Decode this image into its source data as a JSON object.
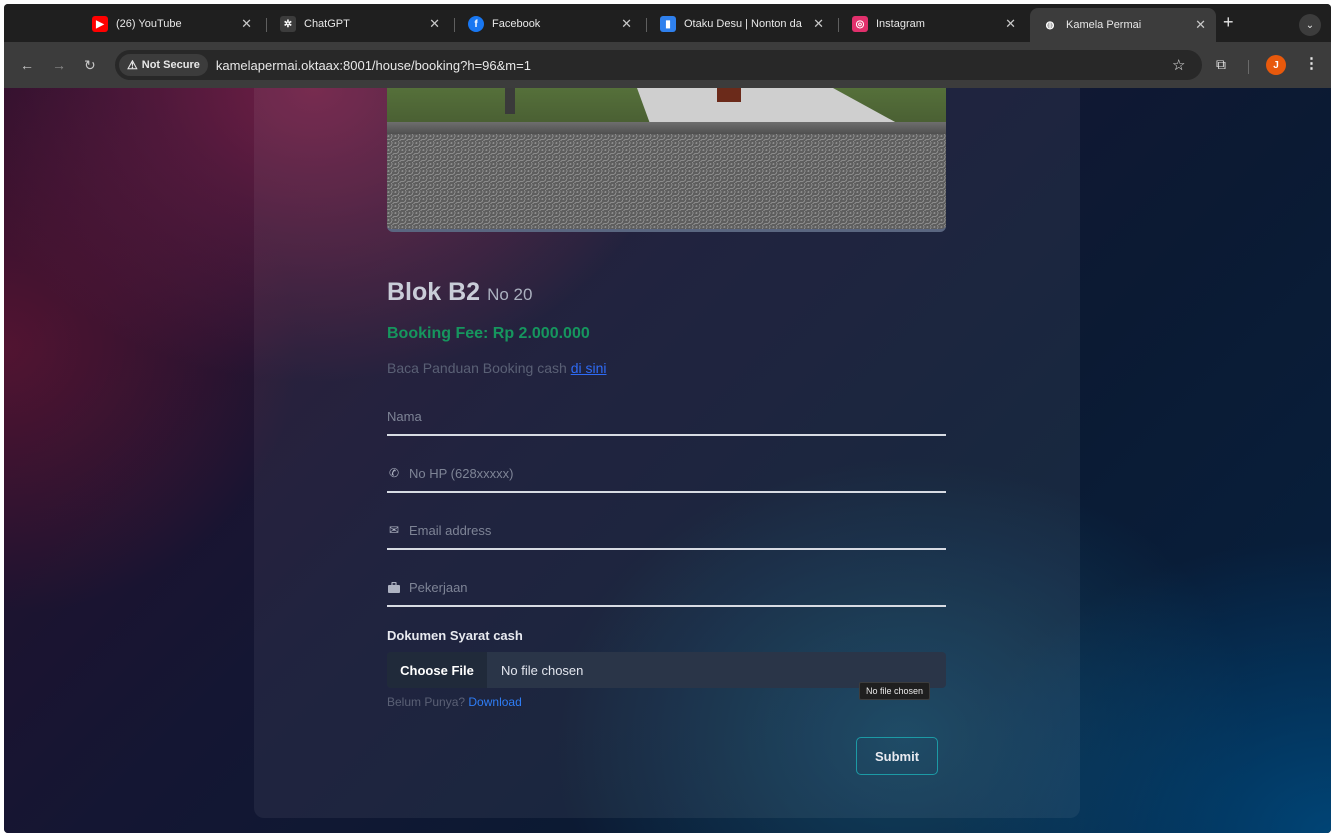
{
  "browser": {
    "tabs": [
      {
        "title": "(26) YouTube",
        "favicon": "youtube-icon",
        "color": "#ff0000",
        "glyph": "▶"
      },
      {
        "title": "ChatGPT",
        "favicon": "chatgpt-icon",
        "color": "#3c3c3c",
        "glyph": "✲"
      },
      {
        "title": "Facebook",
        "favicon": "facebook-icon",
        "color": "#1877f2",
        "glyph": "f"
      },
      {
        "title": "Otaku Desu | Nonton da",
        "favicon": "otakudesu-icon",
        "color": "#2f80ed",
        "glyph": "▮"
      },
      {
        "title": "Instagram",
        "favicon": "instagram-icon",
        "color": "#e1306c",
        "glyph": "◎"
      },
      {
        "title": "Kamela Permai",
        "favicon": "globe-icon",
        "color": "#3c3c3c",
        "glyph": "◍"
      }
    ],
    "security_label": "Not Secure",
    "url": "kamelapermai.oktaax:8001/house/booking?h=96&m=1",
    "profile_initial": "J"
  },
  "house": {
    "blok": "Blok B2",
    "nomor": "No 20",
    "booking_fee": "Booking Fee: Rp 2.000.000",
    "guide_text": "Baca Panduan Booking cash",
    "guide_link": "di sini"
  },
  "form": {
    "nama_placeholder": "Nama",
    "hp_placeholder": "No HP (628xxxxx)",
    "email_placeholder": "Email address",
    "pekerjaan_placeholder": "Pekerjaan",
    "doc_label": "Dokumen Syarat cash",
    "choose_file": "Choose File",
    "file_status": "No file chosen",
    "tooltip": "No file chosen",
    "belum_punya": "Belum Punya?",
    "download": "Download",
    "submit": "Submit"
  },
  "colors": {
    "fee": "#16965e",
    "link": "#2e6bf6",
    "submit_border": "#1c9aa5"
  }
}
